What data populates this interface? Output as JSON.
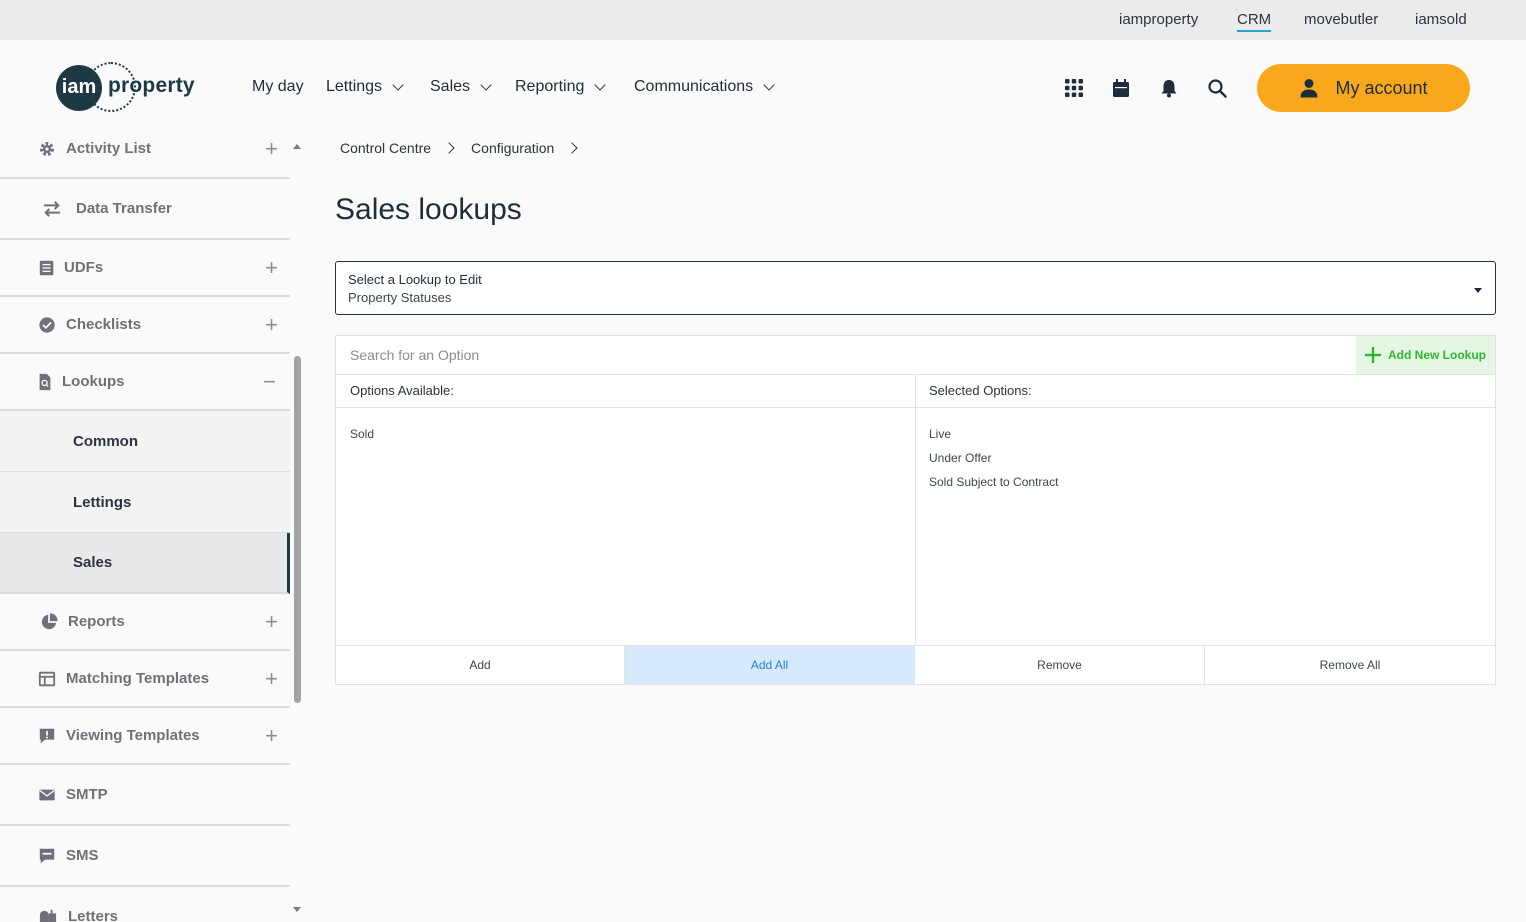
{
  "top_links": [
    "iamproperty",
    "CRM",
    "movebutler",
    "iamsold"
  ],
  "active_top_link": "CRM",
  "logo": {
    "badge": "iam",
    "word": "property"
  },
  "nav": [
    {
      "label": "My day"
    },
    {
      "label": "Lettings"
    },
    {
      "label": "Sales"
    },
    {
      "label": "Reporting"
    },
    {
      "label": "Communications"
    }
  ],
  "header_icons": [
    "apps-grid-icon",
    "calendar-icon",
    "bell-icon",
    "search-icon"
  ],
  "account_label": "My account",
  "sidebar": {
    "items": [
      {
        "label": "Activity List",
        "icon": "gear-icon",
        "toggle": "+"
      },
      {
        "label": "Data Transfer",
        "icon": "swap-arrows-icon",
        "toggle": ""
      },
      {
        "label": "UDFs",
        "icon": "list-icon",
        "toggle": "+"
      },
      {
        "label": "Checklists",
        "icon": "check-circle-icon",
        "toggle": "+"
      },
      {
        "label": "Lookups",
        "icon": "document-search-icon",
        "toggle": "−"
      },
      {
        "label": "Reports",
        "icon": "pie-chart-icon",
        "toggle": "+"
      },
      {
        "label": "Matching Templates",
        "icon": "template-icon",
        "toggle": "+"
      },
      {
        "label": "Viewing Templates",
        "icon": "alert-message-icon",
        "toggle": "+"
      },
      {
        "label": "SMTP",
        "icon": "envelope-icon",
        "toggle": ""
      },
      {
        "label": "SMS",
        "icon": "sms-icon",
        "toggle": ""
      },
      {
        "label": "Letters",
        "icon": "mailbox-icon",
        "toggle": ""
      }
    ],
    "lookups_sub": [
      "Common",
      "Lettings",
      "Sales"
    ],
    "active_sub": "Sales"
  },
  "breadcrumb": [
    "Control Centre",
    "Configuration"
  ],
  "page_title": "Sales lookups",
  "lookup_select": {
    "label": "Select a Lookup to Edit",
    "value": "Property Statuses"
  },
  "search": {
    "placeholder": "Search for an Option"
  },
  "add_new_lookup": "Add New Lookup",
  "options_available": {
    "header": "Options Available:",
    "items": [
      "Sold"
    ]
  },
  "selected_options": {
    "header": "Selected Options:",
    "items": [
      "Live",
      "Under Offer",
      "Sold Subject to Contract"
    ]
  },
  "actions": [
    "Add",
    "Add All",
    "Remove",
    "Remove All"
  ],
  "colors": {
    "accent": "#f9a81b",
    "brand": "#1d3a44",
    "success": "#2db82d",
    "highlight": "#d7eafd"
  }
}
